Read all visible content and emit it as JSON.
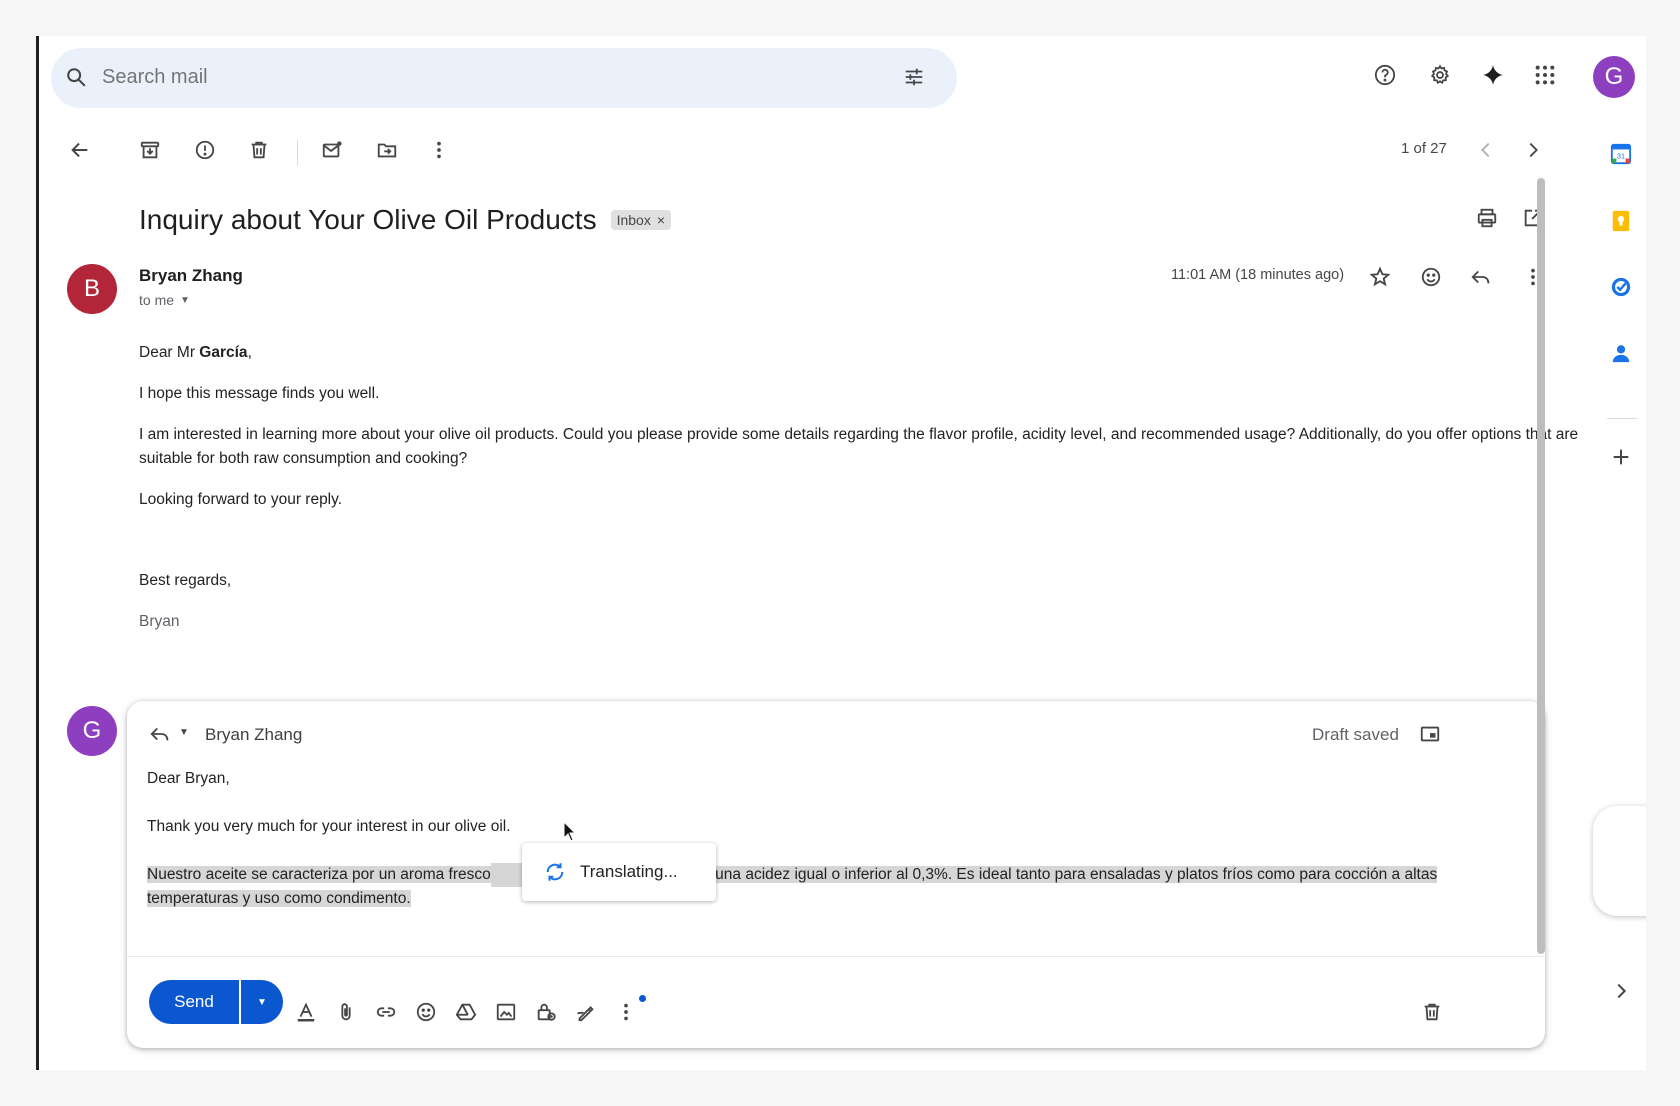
{
  "search": {
    "placeholder": "Search mail"
  },
  "toolbar": {
    "pager": "1 of 27"
  },
  "email": {
    "subject": "Inquiry about Your Olive Oil Products",
    "label": "Inbox",
    "sender": "Bryan Zhang",
    "sender_initial": "B",
    "to": "to me",
    "timestamp": "11:01 AM (18 minutes ago)",
    "body": {
      "greeting_prefix": "Dear Mr",
      "greeting_name": "García",
      "greeting_suffix": ",",
      "p1": "I hope this message finds you well.",
      "p2": "I am interested in learning more about your olive oil products. Could you please provide some details regarding the flavor profile, acidity level, and recommended usage? Additionally, do you offer options that are suitable for both raw consumption and cooking?",
      "p3": "Looking forward to your reply.",
      "closing": "Best regards,",
      "signature": "Bryan"
    }
  },
  "reply": {
    "user_initial": "G",
    "recipient": "Bryan Zhang",
    "status": "Draft saved",
    "greeting": "Dear Bryan,",
    "line1": "Thank you very much for your interest in our olive oil.",
    "selected_part1": "Nuestro aceite se caracteriza por un aroma fresco",
    "selected_part2": "s, y una acidez igual o inferior al 0,3%. Es ideal tanto para ensaladas y platos fríos como para cocción a altas",
    "selected_line2": "temperaturas y uso como condimento.",
    "translating": "Translating...",
    "send_label": "Send"
  },
  "header": {
    "account_initial": "G"
  },
  "colors": {
    "accent": "#0b57d0",
    "sender_avatar": "#b3263a",
    "user_avatar": "#8e3fbf"
  }
}
